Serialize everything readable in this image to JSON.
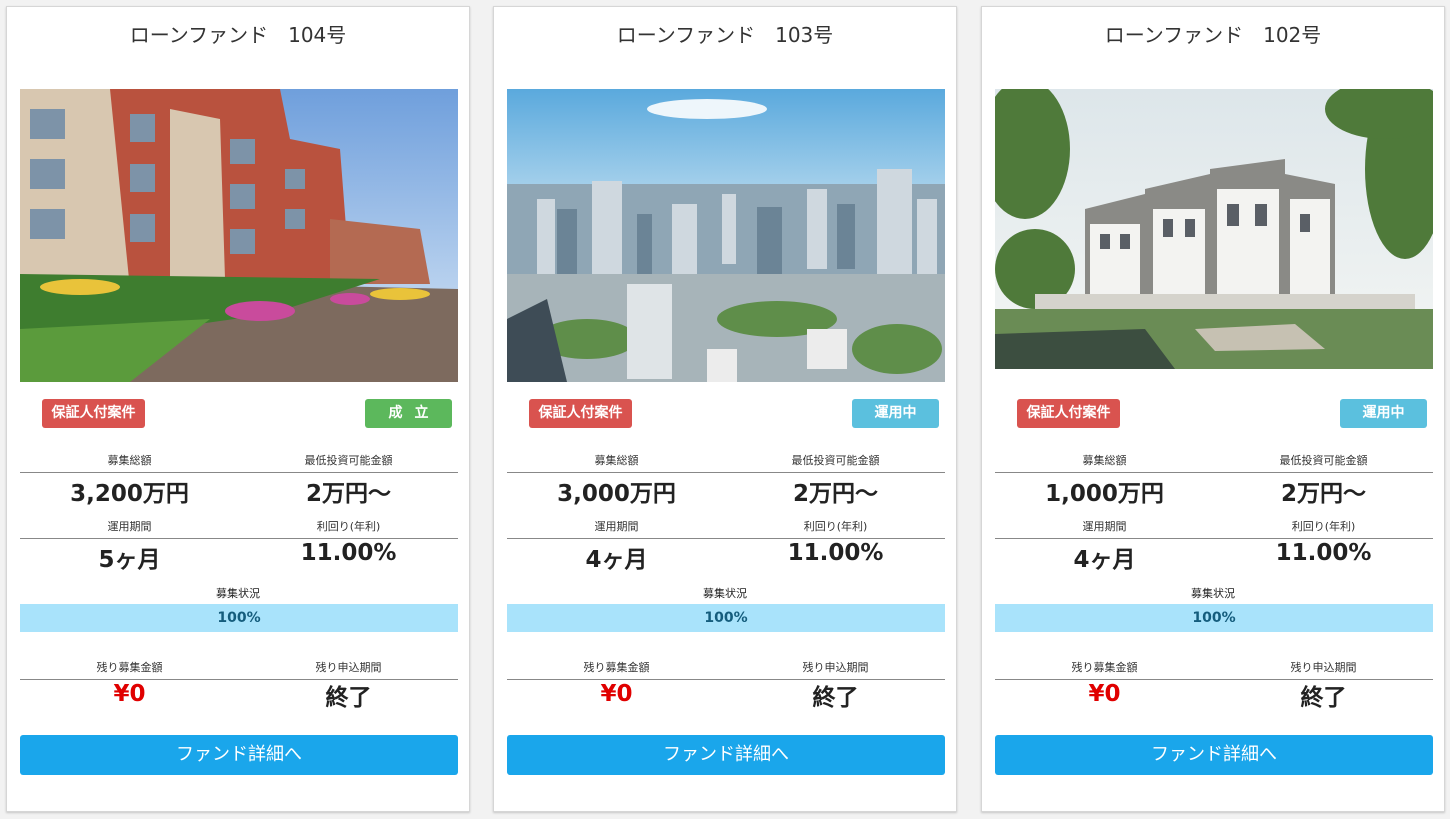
{
  "funds": [
    {
      "title": "ローンファンド　104号",
      "image": "apartment-building-photo",
      "guarantee_badge": "保証人付案件",
      "status_badge": "成立",
      "status_color": "#5cb85c",
      "total_label": "募集総額",
      "total_value": "3,200万円",
      "min_label": "最低投資可能金額",
      "min_value": "2万円〜",
      "period_label": "運用期間",
      "period_value": "5ヶ月",
      "yield_label": "利回り(年利)",
      "yield_value": "11.00%",
      "progress_label": "募集状況",
      "progress_text": "100%",
      "progress": 1.0,
      "remaining_label": "残り募集金額",
      "remaining_value": "¥0",
      "deadline_label": "残り申込期間",
      "deadline_value": "終了",
      "button": "ファンド詳細へ"
    },
    {
      "title": "ローンファンド　103号",
      "image": "city-skyline-photo",
      "guarantee_badge": "保証人付案件",
      "status_badge": "運用中",
      "status_color": "#5bc0de",
      "total_label": "募集総額",
      "total_value": "3,000万円",
      "min_label": "最低投資可能金額",
      "min_value": "2万円〜",
      "period_label": "運用期間",
      "period_value": "4ヶ月",
      "yield_label": "利回り(年利)",
      "yield_value": "11.00%",
      "progress_label": "募集状況",
      "progress_text": "100%",
      "progress": 1.0,
      "remaining_label": "残り募集金額",
      "remaining_value": "¥0",
      "deadline_label": "残り申込期間",
      "deadline_value": "終了",
      "button": "ファンド詳細へ"
    },
    {
      "title": "ローンファンド　102号",
      "image": "modern-townhouse-photo",
      "guarantee_badge": "保証人付案件",
      "status_badge": "運用中",
      "status_color": "#5bc0de",
      "total_label": "募集総額",
      "total_value": "1,000万円",
      "min_label": "最低投資可能金額",
      "min_value": "2万円〜",
      "period_label": "運用期間",
      "period_value": "4ヶ月",
      "yield_label": "利回り(年利)",
      "yield_value": "11.00%",
      "progress_label": "募集状況",
      "progress_text": "100%",
      "progress": 1.0,
      "remaining_label": "残り募集金額",
      "remaining_value": "¥0",
      "deadline_label": "残り申込期間",
      "deadline_value": "終了",
      "button": "ファンド詳細へ"
    }
  ]
}
